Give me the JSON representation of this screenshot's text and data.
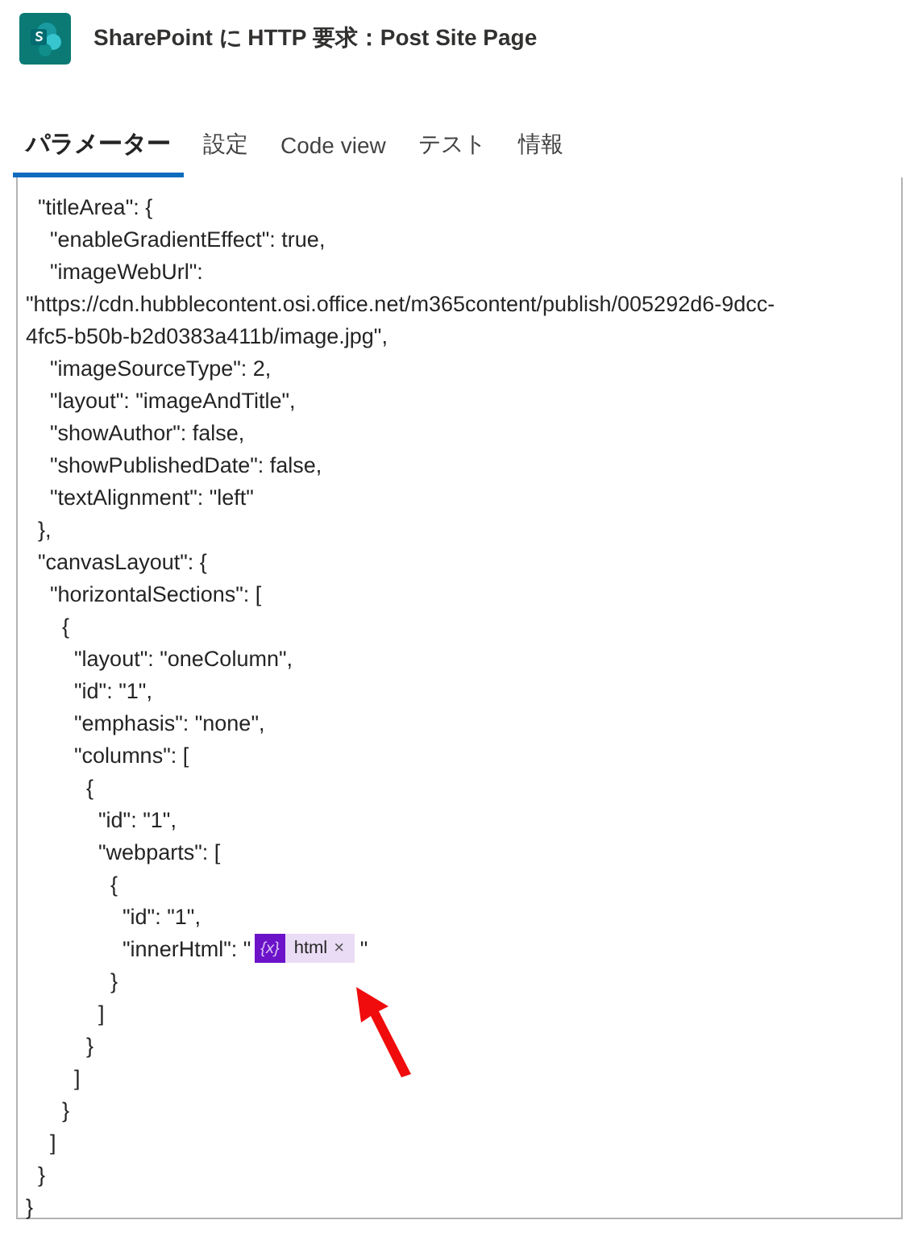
{
  "header": {
    "title": "SharePoint に HTTP 要求：Post Site Page"
  },
  "tabs": [
    {
      "label": "パラメーター",
      "selected": true
    },
    {
      "label": "設定",
      "selected": false
    },
    {
      "label": "Code view",
      "selected": false
    },
    {
      "label": "テスト",
      "selected": false
    },
    {
      "label": "情報",
      "selected": false
    }
  ],
  "editor": {
    "lines": [
      {
        "text": "  \"titleArea\": {"
      },
      {
        "text": "    \"enableGradientEffect\": true,"
      },
      {
        "text": "    \"imageWebUrl\":"
      },
      {
        "text": "\"https://cdn.hubblecontent.osi.office.net/m365content/publish/005292d6-9dcc-"
      },
      {
        "text": "4fc5-b50b-b2d0383a411b/image.jpg\","
      },
      {
        "text": "    \"imageSourceType\": 2,"
      },
      {
        "text": "    \"layout\": \"imageAndTitle\","
      },
      {
        "text": "    \"showAuthor\": false,"
      },
      {
        "text": "    \"showPublishedDate\": false,"
      },
      {
        "text": "    \"textAlignment\": \"left\""
      },
      {
        "text": "  },"
      },
      {
        "text": "  \"canvasLayout\": {"
      },
      {
        "text": "    \"horizontalSections\": ["
      },
      {
        "text": "      {"
      },
      {
        "text": "        \"layout\": \"oneColumn\","
      },
      {
        "text": "        \"id\": \"1\","
      },
      {
        "text": "        \"emphasis\": \"none\","
      },
      {
        "text": "        \"columns\": ["
      },
      {
        "text": "          {"
      },
      {
        "text": "            \"id\": \"1\","
      },
      {
        "text": "            \"webparts\": ["
      },
      {
        "text": "              {"
      },
      {
        "text": "                \"id\": \"1\","
      },
      {
        "kind": "token",
        "text": "                \"innerHtml\": \"",
        "token_icon": "{x}",
        "token": "html",
        "remove": "×",
        "after": " \""
      },
      {
        "text": "              }"
      },
      {
        "text": "            ]"
      },
      {
        "text": "          }"
      },
      {
        "text": "        ]"
      },
      {
        "text": "      }"
      },
      {
        "text": "    ]"
      },
      {
        "text": "  }"
      },
      {
        "text": "}"
      }
    ]
  }
}
